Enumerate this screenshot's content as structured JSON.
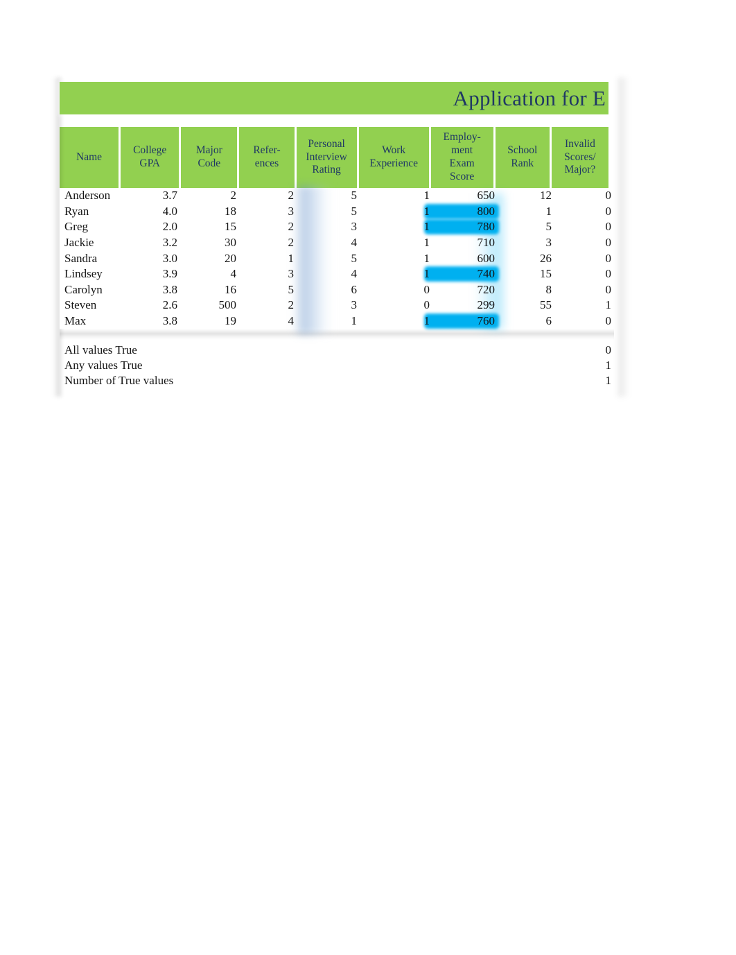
{
  "document": {
    "title": "Application for E",
    "accent_green": "#92D050",
    "title_text_color": "#1F3864",
    "highlight_cyan": "#00B0F0"
  },
  "table": {
    "columns": [
      {
        "key": "name",
        "label_lines": [
          "Name"
        ]
      },
      {
        "key": "gpa",
        "label_lines": [
          "College",
          "GPA"
        ]
      },
      {
        "key": "major",
        "label_lines": [
          "Major",
          "Code"
        ]
      },
      {
        "key": "ref",
        "label_lines": [
          "Refer-",
          "ences"
        ]
      },
      {
        "key": "pir",
        "label_lines": [
          "Personal",
          "Interview",
          "Rating"
        ]
      },
      {
        "key": "work",
        "label_lines": [
          "Work",
          "Experience"
        ]
      },
      {
        "key": "exam",
        "label_lines": [
          "Employ-",
          "ment",
          "Exam",
          "Score"
        ]
      },
      {
        "key": "rank",
        "label_lines": [
          "School",
          "Rank"
        ]
      },
      {
        "key": "inv",
        "label_lines": [
          "Invalid",
          "Scores/",
          "Major?"
        ]
      }
    ],
    "header": {
      "name": "Name",
      "gpa_l1": "College",
      "gpa_l2": "GPA",
      "major_l1": "Major",
      "major_l2": "Code",
      "ref_l1": "Refer-",
      "ref_l2": "ences",
      "pir_l1": "Personal",
      "pir_l2": "Interview",
      "pir_l3": "Rating",
      "work_l1": "Work",
      "work_l2": "Experience",
      "exam_l1": "Employ-",
      "exam_l2": "ment",
      "exam_l3": "Exam",
      "exam_l4": "Score",
      "rank_l1": "School",
      "rank_l2": "Rank",
      "inv_l1": "Invalid",
      "inv_l2": "Scores/",
      "inv_l3": "Major?"
    },
    "rows": [
      {
        "name": "Anderson",
        "gpa": "3.7",
        "major": "2",
        "ref": "2",
        "pir": "5",
        "work": "1",
        "exam": "650",
        "exam_highlight": false,
        "rank": "12",
        "inv": "0"
      },
      {
        "name": "Ryan",
        "gpa": "4.0",
        "major": "18",
        "ref": "3",
        "pir": "5",
        "work": "1",
        "exam": "800",
        "exam_highlight": true,
        "rank": "1",
        "inv": "0"
      },
      {
        "name": "Greg",
        "gpa": "2.0",
        "major": "15",
        "ref": "2",
        "pir": "3",
        "work": "1",
        "exam": "780",
        "exam_highlight": true,
        "rank": "5",
        "inv": "0"
      },
      {
        "name": "Jackie",
        "gpa": "3.2",
        "major": "30",
        "ref": "2",
        "pir": "4",
        "work": "1",
        "exam": "710",
        "exam_highlight": false,
        "rank": "3",
        "inv": "0"
      },
      {
        "name": "Sandra",
        "gpa": "3.0",
        "major": "20",
        "ref": "1",
        "pir": "5",
        "work": "1",
        "exam": "600",
        "exam_highlight": false,
        "rank": "26",
        "inv": "0"
      },
      {
        "name": "Lindsey",
        "gpa": "3.9",
        "major": "4",
        "ref": "3",
        "pir": "4",
        "work": "1",
        "exam": "740",
        "exam_highlight": true,
        "rank": "15",
        "inv": "0"
      },
      {
        "name": "Carolyn",
        "gpa": "3.8",
        "major": "16",
        "ref": "5",
        "pir": "6",
        "work": "0",
        "exam": "720",
        "exam_highlight": false,
        "rank": "8",
        "inv": "0"
      },
      {
        "name": "Steven",
        "gpa": "2.6",
        "major": "500",
        "ref": "2",
        "pir": "3",
        "work": "0",
        "exam": "299",
        "exam_highlight": false,
        "rank": "55",
        "inv": "1"
      },
      {
        "name": "Max",
        "gpa": "3.8",
        "major": "19",
        "ref": "4",
        "pir": "1",
        "work": "1",
        "exam": "760",
        "exam_highlight": true,
        "rank": "6",
        "inv": "0"
      }
    ]
  },
  "summary": [
    {
      "label": "All values True",
      "value": "0"
    },
    {
      "label": "Any values True",
      "value": "1"
    },
    {
      "label": "Number of True values",
      "value": "1"
    }
  ]
}
